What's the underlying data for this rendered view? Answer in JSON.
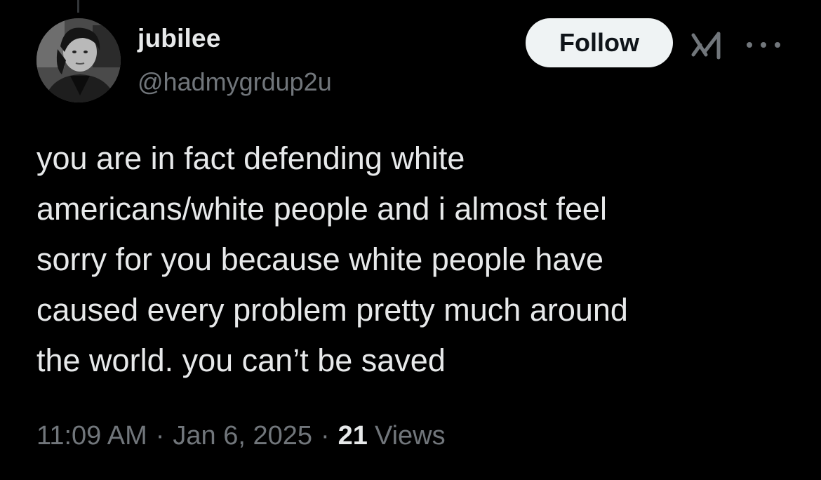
{
  "author": {
    "display_name": "jubilee",
    "handle": "@hadmygrdup2u",
    "avatar_icon": "profile-photo"
  },
  "header": {
    "follow_label": "Follow",
    "grok_icon": "grok-icon",
    "more_icon": "more-icon"
  },
  "tweet": {
    "text": "you are in fact defending white\namericans/white people and i almost feel\nsorry for you because white people have\ncaused every problem pretty much around\nthe world. you can’t be saved"
  },
  "meta": {
    "time": "11:09 AM",
    "separator": "·",
    "date": "Jan 6, 2025",
    "views_count": "21",
    "views_label": "Views"
  },
  "colors": {
    "background": "#000000",
    "text_primary": "#e7e9ea",
    "text_secondary": "#71767b",
    "follow_bg": "#eff3f4",
    "follow_text": "#0f1419"
  }
}
